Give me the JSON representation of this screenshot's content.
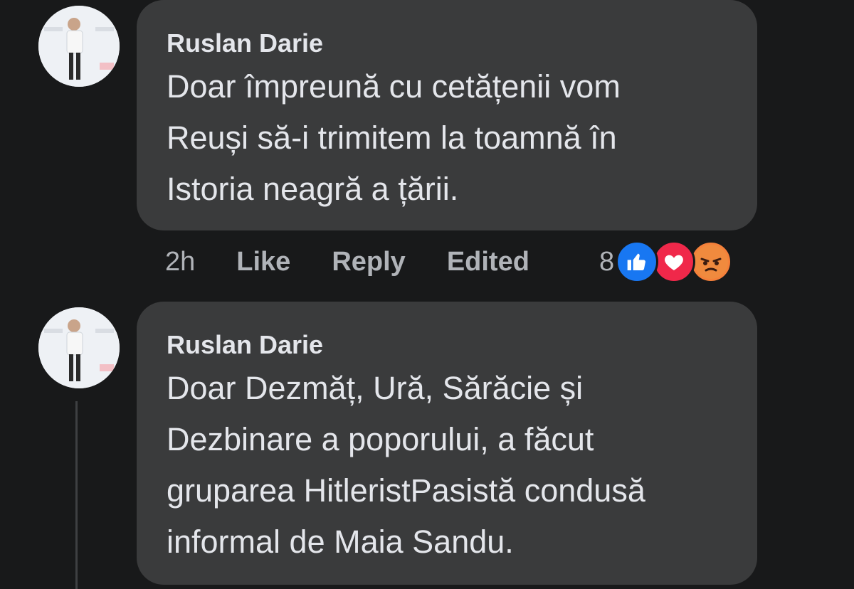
{
  "comments": [
    {
      "author": "Ruslan Darie",
      "text_lines": [
        "Doar împreună cu cetățenii vom",
        "Reuși să-i trimitem la toamnă în",
        "Istoria neagră a țării."
      ],
      "time": "2h",
      "like_label": "Like",
      "reply_label": "Reply",
      "edited_label": "Edited",
      "reaction_count": "8",
      "reactions": [
        "like-icon",
        "love-icon",
        "angry-icon"
      ]
    },
    {
      "author": "Ruslan Darie",
      "text_lines": [
        "Doar Dezmăț, Ură, Sărăcie și",
        "Dezbinare a poporului, a făcut",
        "gruparea HitleristPasistă condusă",
        "informal de Maia Sandu."
      ]
    }
  ],
  "colors": {
    "background": "#18191a",
    "bubble": "#3a3b3c",
    "text": "#e4e6eb",
    "muted": "#b0b3b8",
    "like": "#1877f2",
    "love": "#f0284a",
    "angry": "#f5803a"
  }
}
